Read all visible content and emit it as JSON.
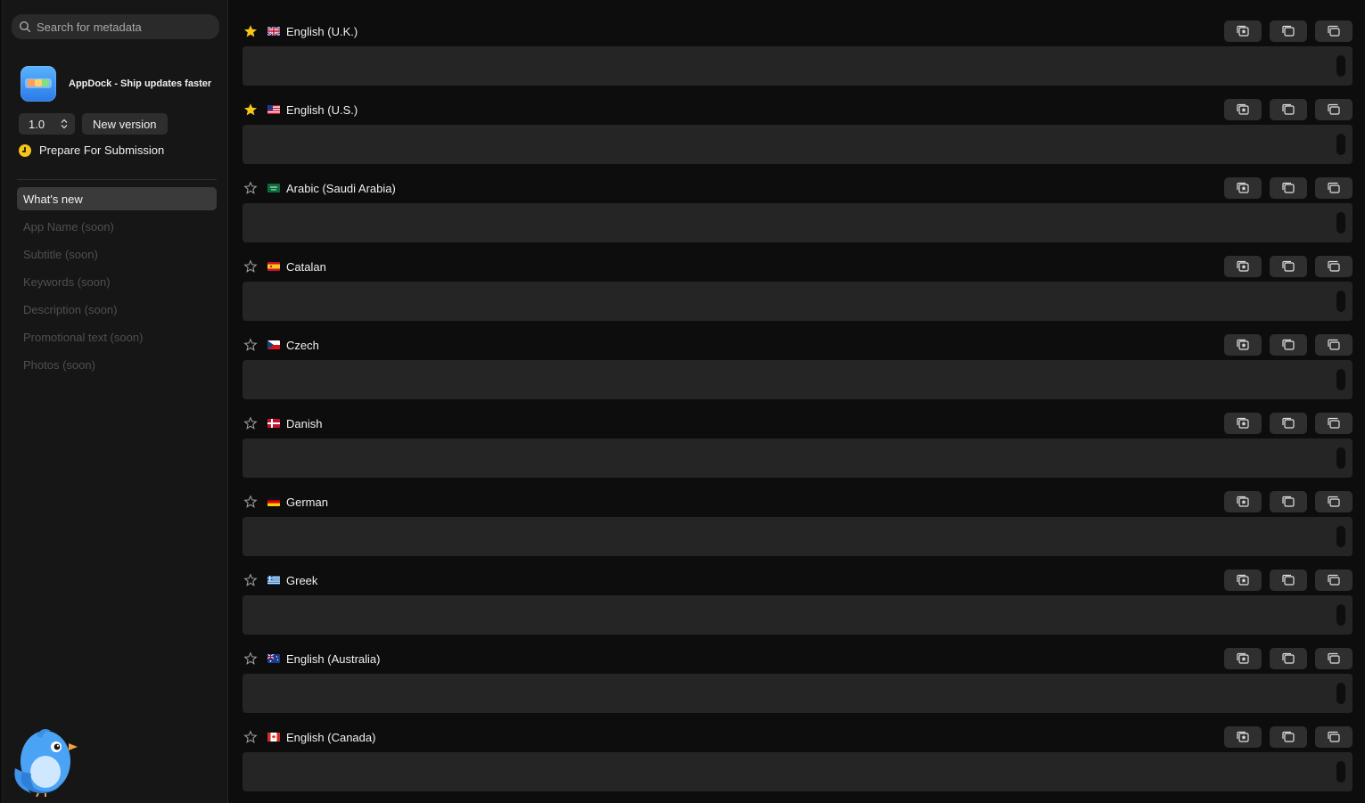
{
  "search": {
    "placeholder": "Search for metadata",
    "icon": "search-icon"
  },
  "app": {
    "title": "AppDock - Ship updates faster",
    "icon": "app-dock-icon"
  },
  "version": {
    "value": "1.0",
    "new_version_label": "New version"
  },
  "status": {
    "label": "Prepare For Submission",
    "color": "#f5c518"
  },
  "nav": {
    "items": [
      {
        "label": "What's new",
        "active": true
      },
      {
        "label": "App Name (soon)",
        "active": false
      },
      {
        "label": "Subtitle (soon)",
        "active": false
      },
      {
        "label": "Keywords (soon)",
        "active": false
      },
      {
        "label": "Description (soon)",
        "active": false
      },
      {
        "label": "Promotional text (soon)",
        "active": false
      },
      {
        "label": "Photos (soon)",
        "active": false
      }
    ]
  },
  "languages": [
    {
      "name": "English (U.K.)",
      "starred": true,
      "flag": "uk-flag"
    },
    {
      "name": "English (U.S.)",
      "starred": true,
      "flag": "us-flag"
    },
    {
      "name": "Arabic (Saudi Arabia)",
      "starred": false,
      "flag": "saudi-arabia-flag"
    },
    {
      "name": "Catalan",
      "starred": false,
      "flag": "catalan-flag"
    },
    {
      "name": "Czech",
      "starred": false,
      "flag": "czech-flag"
    },
    {
      "name": "Danish",
      "starred": false,
      "flag": "danish-flag"
    },
    {
      "name": "German",
      "starred": false,
      "flag": "german-flag"
    },
    {
      "name": "Greek",
      "starred": false,
      "flag": "greek-flag"
    },
    {
      "name": "English (Australia)",
      "starred": false,
      "flag": "australia-flag"
    },
    {
      "name": "English (Canada)",
      "starred": false,
      "flag": "canada-flag"
    }
  ],
  "row_actions": [
    "copy-from-favorite-icon",
    "copy-icon",
    "copy-all-icon"
  ],
  "colors": {
    "accent_star": "#f5c518",
    "field_bg": "#252525",
    "button_bg": "#2f2f2f"
  }
}
